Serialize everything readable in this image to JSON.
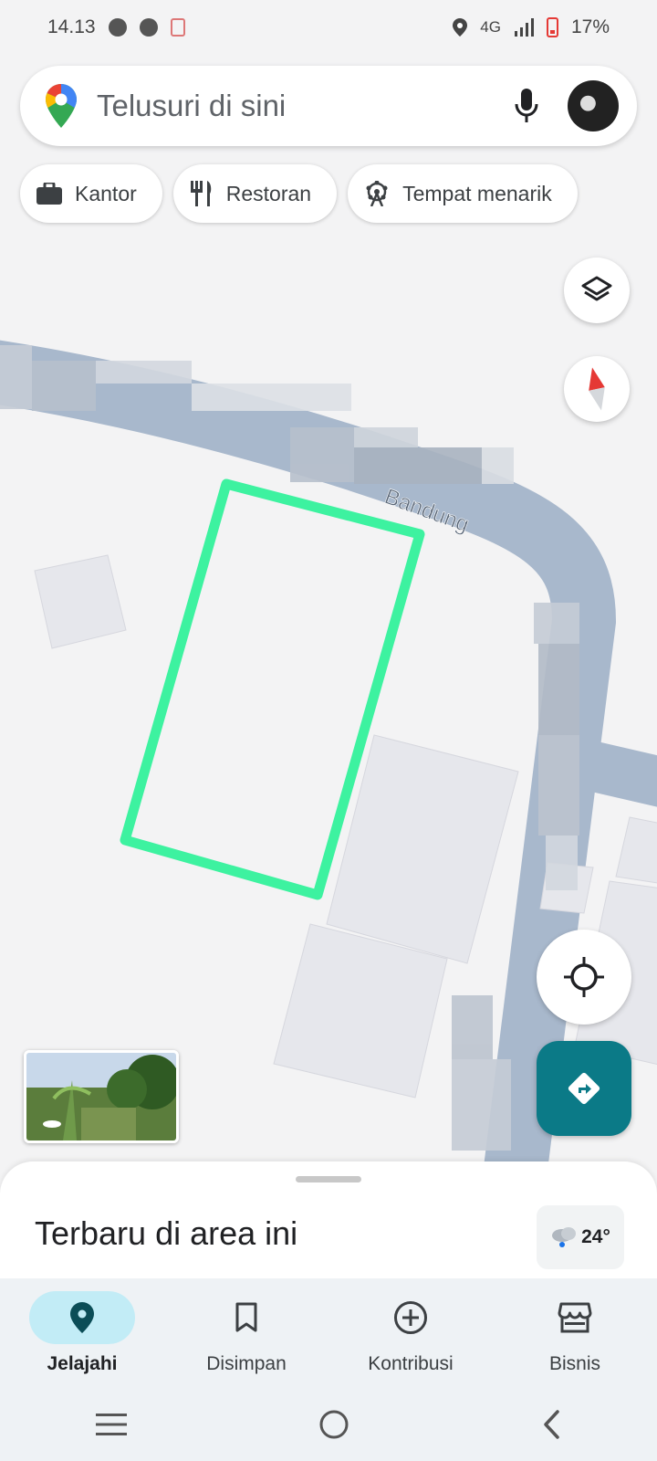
{
  "status_bar": {
    "time": "14.13",
    "network": "4G",
    "battery": "17%",
    "icons": [
      "facebook-icon",
      "messenger-icon",
      "notification-icon",
      "location-icon",
      "signal-icon",
      "battery-icon"
    ]
  },
  "search": {
    "placeholder": "Telusuri di sini",
    "icons": [
      "maps-logo-icon",
      "mic-icon",
      "avatar"
    ]
  },
  "chips": [
    {
      "label": "Kantor",
      "icon": "briefcase-icon"
    },
    {
      "label": "Restoran",
      "icon": "restaurant-icon"
    },
    {
      "label": "Tempat menarik",
      "icon": "ferris-wheel-icon"
    }
  ],
  "map": {
    "road_label": "Bandung",
    "highlight_color": "#3df2a0",
    "road_color": "#a8b8cc"
  },
  "map_controls": {
    "icons": [
      "layers-icon",
      "compass-icon",
      "my-location-icon",
      "directions-icon"
    ]
  },
  "bottom_sheet": {
    "title": "Terbaru di area ini",
    "weather": {
      "temperature": "24°",
      "icon": "cloud-rain-icon"
    }
  },
  "bottom_nav": [
    {
      "label": "Jelajahi",
      "icon": "location-pin-icon",
      "active": true
    },
    {
      "label": "Disimpan",
      "icon": "bookmark-icon",
      "active": false
    },
    {
      "label": "Kontribusi",
      "icon": "add-circle-icon",
      "active": false
    },
    {
      "label": "Bisnis",
      "icon": "store-icon",
      "active": false
    }
  ],
  "system_nav": [
    "recents-icon",
    "home-icon",
    "back-icon"
  ],
  "colors": {
    "accent": "#0b7a87",
    "active_nav_bg": "#c2ecf6"
  }
}
